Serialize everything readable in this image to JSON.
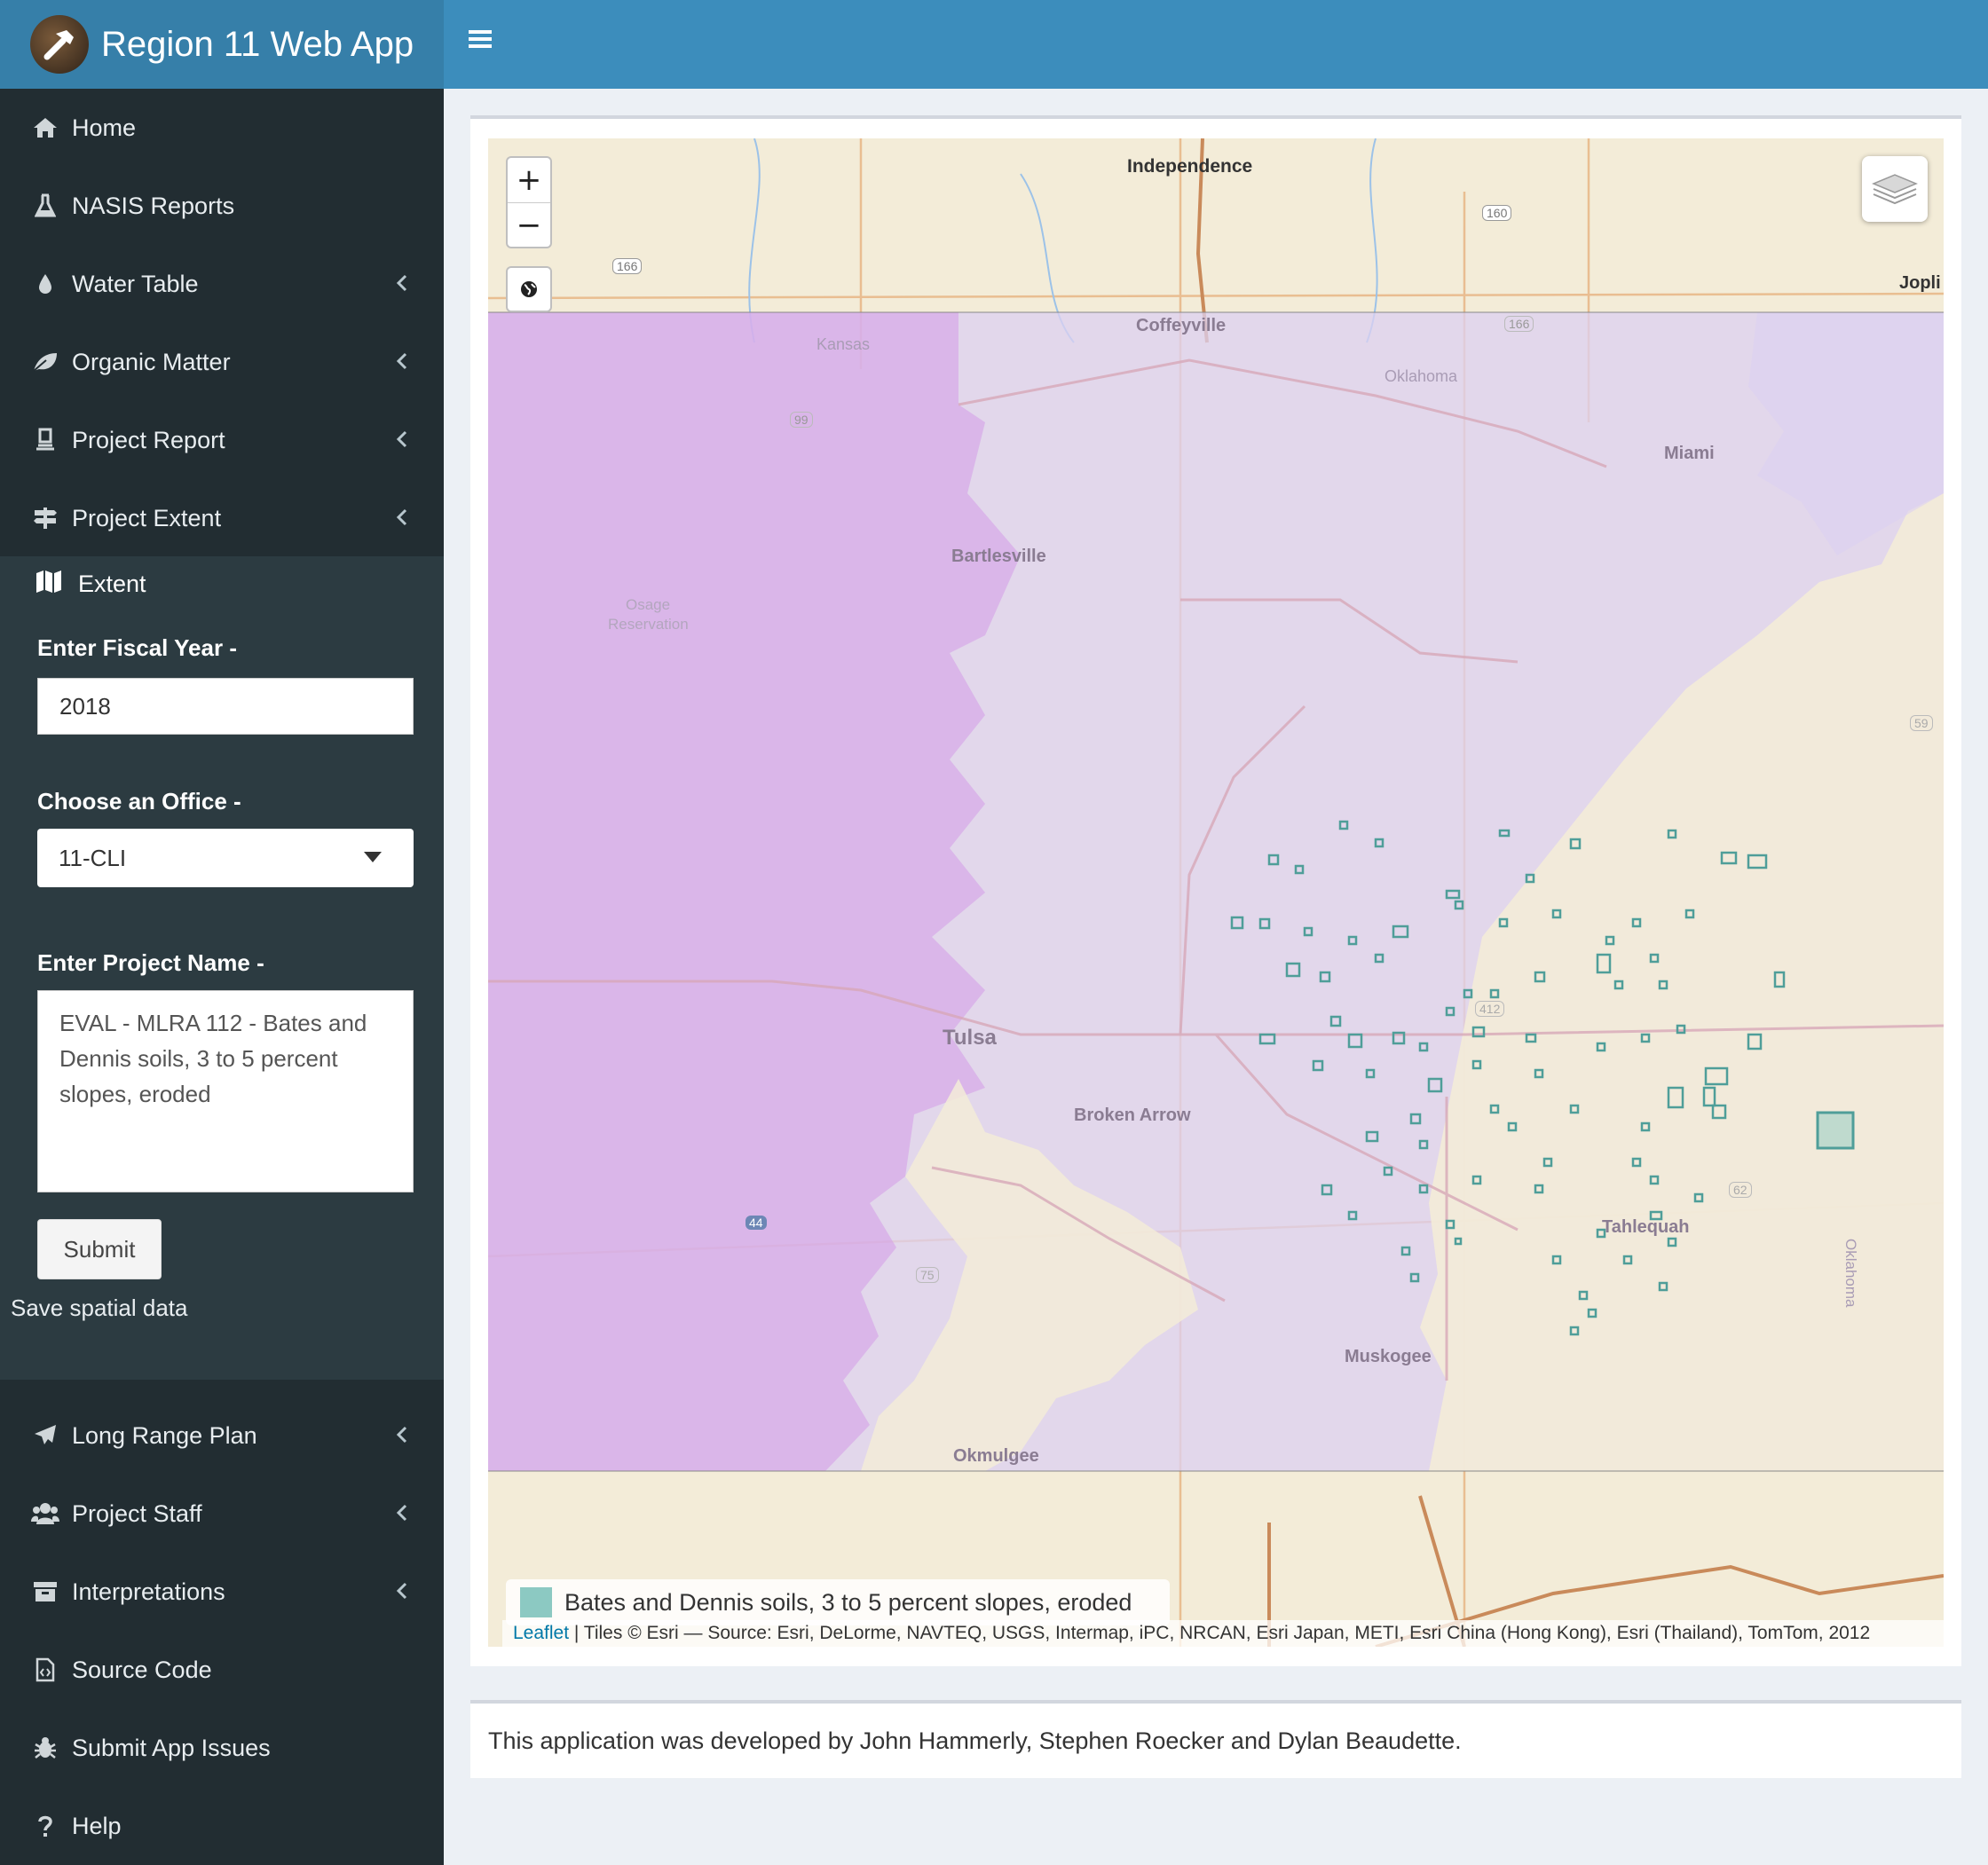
{
  "header": {
    "title": "Region 11 Web App"
  },
  "sidebar": {
    "items_top": [
      {
        "label": "Home",
        "icon": "home-icon",
        "has_children": false
      },
      {
        "label": "NASIS Reports",
        "icon": "flask-icon",
        "has_children": false
      },
      {
        "label": "Water Table",
        "icon": "tint-icon",
        "has_children": true
      },
      {
        "label": "Organic Matter",
        "icon": "leaf-icon",
        "has_children": true
      },
      {
        "label": "Project Report",
        "icon": "file-stack-icon",
        "has_children": true
      },
      {
        "label": "Project Extent",
        "icon": "signpost-icon",
        "has_children": true
      }
    ],
    "extent": {
      "label": "Extent",
      "fiscal_year_label": "Enter Fiscal Year -",
      "fiscal_year_value": "2018",
      "office_label": "Choose an Office -",
      "office_value": "11-CLI",
      "project_name_label": "Enter Project Name -",
      "project_name_value": "EVAL - MLRA 112 - Bates and Dennis soils, 3 to 5 percent slopes, eroded",
      "submit_label": "Submit",
      "save_label": "Save spatial data"
    },
    "items_bottom": [
      {
        "label": "Long Range Plan",
        "icon": "plane-icon",
        "has_children": true
      },
      {
        "label": "Project Staff",
        "icon": "users-icon",
        "has_children": true
      },
      {
        "label": "Interpretations",
        "icon": "archive-icon",
        "has_children": true
      },
      {
        "label": "Source Code",
        "icon": "code-file-icon",
        "has_children": false
      },
      {
        "label": "Submit App Issues",
        "icon": "bug-icon",
        "has_children": false
      },
      {
        "label": "Help",
        "icon": "question-icon",
        "has_children": false
      }
    ]
  },
  "map": {
    "zoom_in": "+",
    "zoom_out": "−",
    "place_labels": {
      "independence": "Independence",
      "coffeyville": "Coffeyville",
      "kansas": "Kansas",
      "oklahoma": "Oklahoma",
      "miami": "Miami",
      "bartlesville": "Bartlesville",
      "osage": "Osage",
      "reservation": "Reservation",
      "tulsa": "Tulsa",
      "broken_arrow": "Broken Arrow",
      "tahlequah": "Tahlequah",
      "muskogee": "Muskogee",
      "okmulgee": "Okmulgee",
      "joplin": "Jopli",
      "oklahoma_vertical": "Oklahoma"
    },
    "road_shields": [
      "166",
      "160",
      "166",
      "99",
      "412",
      "62",
      "75",
      "44",
      "59"
    ],
    "legend_label": "Bates and Dennis soils, 3 to 5 percent slopes, eroded",
    "attribution_link": "Leaflet",
    "attribution_text": " | Tiles © Esri — Source: Esri, DeLorme, NAVTEQ, USGS, Intermap, iPC, NRCAN, Esri Japan, METI, Esri China (Hong Kong), Esri (Thailand), TomTom, 2012",
    "colors": {
      "extent_fill": "#d9c6f0",
      "west_fill": "#d99ae8",
      "polygon": "#5fa9a4",
      "header": "#3c8dbc"
    }
  },
  "footer": {
    "credits": "This application was developed by John Hammerly, Stephen Roecker and Dylan Beaudette."
  }
}
